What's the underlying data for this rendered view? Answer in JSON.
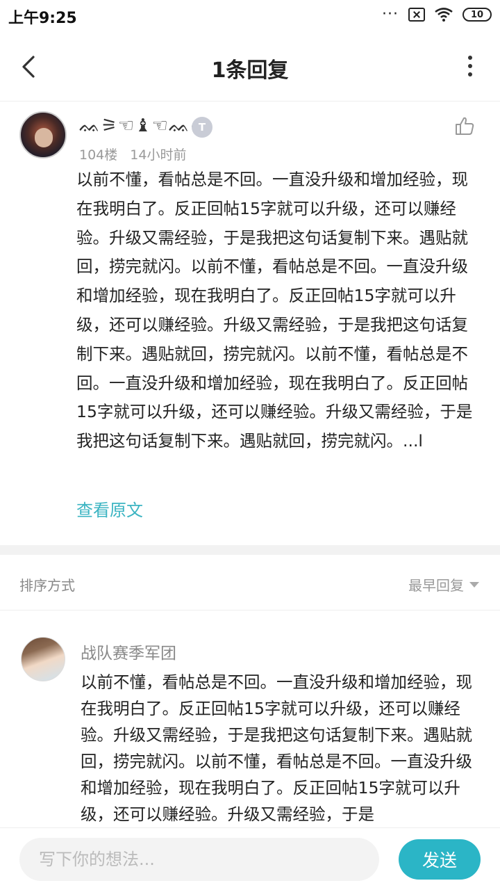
{
  "status_bar": {
    "time": "上午9:25",
    "battery": "10"
  },
  "nav": {
    "title": "1条回复"
  },
  "post": {
    "username": "ᨐ⚞☜♝☜ᨐᨑ",
    "level": "T",
    "floor": "104楼",
    "time": "14小时前",
    "content": "以前不懂，看帖总是不回。一直没升级和增加经验，现在我明白了。反正回帖15字就可以升级，还可以赚经验。升级又需经验，于是我把这句话复制下来。遇贴就回，捞完就闪。以前不懂，看帖总是不回。一直没升级和增加经验，现在我明白了。反正回帖15字就可以升级，还可以赚经验。升级又需经验，于是我把这句话复制下来。遇贴就回，捞完就闪。以前不懂，看帖总是不回。一直没升级和增加经验，现在我明白了。反正回帖15字就可以升级，还可以赚经验。升级又需经验，于是我把这句话复制下来。遇贴就回，捞完就闪。...l",
    "view_original": "查看原文"
  },
  "sort": {
    "label": "排序方式",
    "value": "最早回复"
  },
  "reply": {
    "username": "战队赛季军团",
    "content": "以前不懂，看帖总是不回。一直没升级和增加经验，现在我明白了。反正回帖15字就可以升级，还可以赚经验。升级又需经验，于是我把这句话复制下来。遇贴就回，捞完就闪。以前不懂，看帖总是不回。一直没升级和增加经验，现在我明白了。反正回帖15字就可以升级，还可以赚经验。升级又需经验，于是"
  },
  "bottom_bar": {
    "placeholder": "写下你的想法...",
    "send_label": "发送"
  },
  "colors": {
    "accent": "#2bb5c6",
    "link": "#3bb4c2"
  }
}
